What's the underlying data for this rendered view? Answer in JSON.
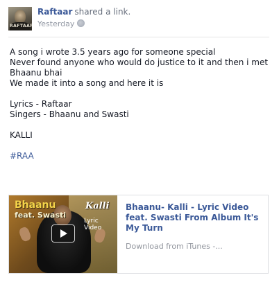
{
  "post": {
    "author": "Raftaar",
    "action": "shared a link.",
    "timestamp": "Yesterday",
    "privacy_icon": "globe-icon",
    "avatar_text": "RAFTAAR",
    "lines": [
      "A song i wrote 3.5 years ago for someone special",
      "Never found anyone who would do justice to it and then i met",
      "Bhaanu bhai",
      "We made it into a song and here it is",
      "",
      "Lyrics - Raftaar",
      "Singers - Bhaanu and Swasti",
      "",
      "KALLI",
      ""
    ],
    "hashtag": "#RAA"
  },
  "share": {
    "thumb_title_1": "Bhaanu",
    "thumb_title_2": "feat. Swasti",
    "thumb_kalli": "Kalli",
    "thumb_lyric": "Lyric Video",
    "title": "Bhaanu- Kalli - Lyric Video feat. Swasti From Album It's My Turn",
    "source": "Download from iTunes -..."
  },
  "colors": {
    "link": "#3b5998",
    "meta": "#9197a3",
    "text": "#141823"
  }
}
